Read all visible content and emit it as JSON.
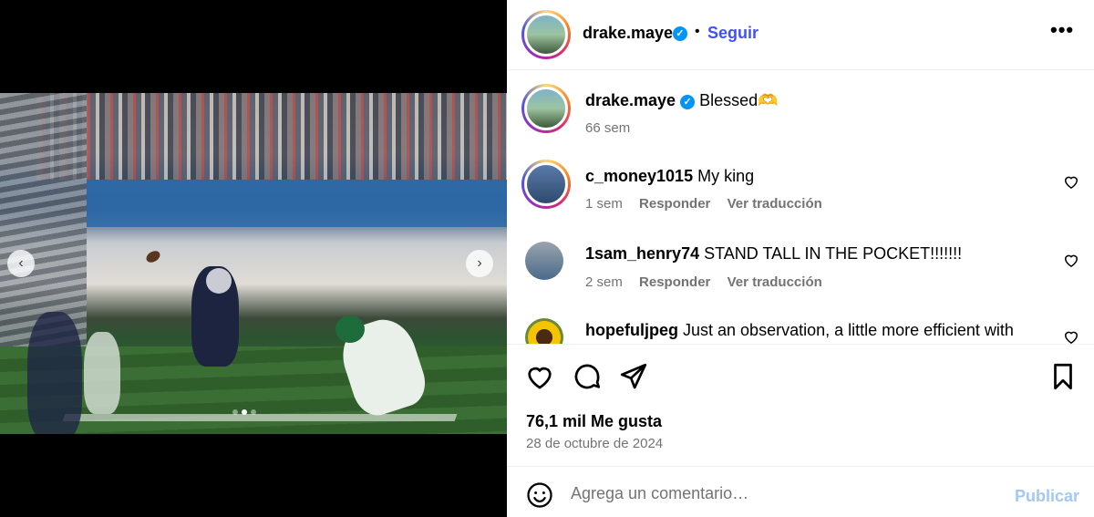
{
  "post": {
    "image": {
      "alt_icon_prev": "chevron-left-icon",
      "alt_icon_next": "chevron-right-icon",
      "carousel_total": 3,
      "carousel_active": 2,
      "prev_glyph": "‹",
      "next_glyph": "›"
    },
    "header": {
      "username": "drake.maye",
      "verified_glyph": "✓",
      "separator": "•",
      "follow_label": "Seguir",
      "more_glyph": "•••"
    },
    "caption": {
      "username": "drake.maye",
      "text": "Blessed🫶",
      "time": "66 sem"
    },
    "comments": [
      {
        "username": "c_money1015",
        "text": "My king",
        "time": "1 sem",
        "reply_label": "Responder",
        "translate_label": "Ver traducción"
      },
      {
        "username": "1sam_henry74",
        "text": "STAND TALL IN THE POCKET!!!!!!!",
        "time": "2 sem",
        "reply_label": "Responder",
        "translate_label": "Ver traducción"
      },
      {
        "username": "hopefuljpeg",
        "text": "Just an observation, a little more efficient with"
      }
    ],
    "actions": {
      "likes": "76,1 mil Me gusta",
      "date": "28 de octubre de 2024"
    },
    "composer": {
      "placeholder": "Agrega un comentario…",
      "publish_label": "Publicar"
    },
    "colors": {
      "follow": "#4150f7",
      "verified": "#0095f6",
      "publish_disabled": "#a3c8f5",
      "meta_gray": "#737373"
    }
  }
}
